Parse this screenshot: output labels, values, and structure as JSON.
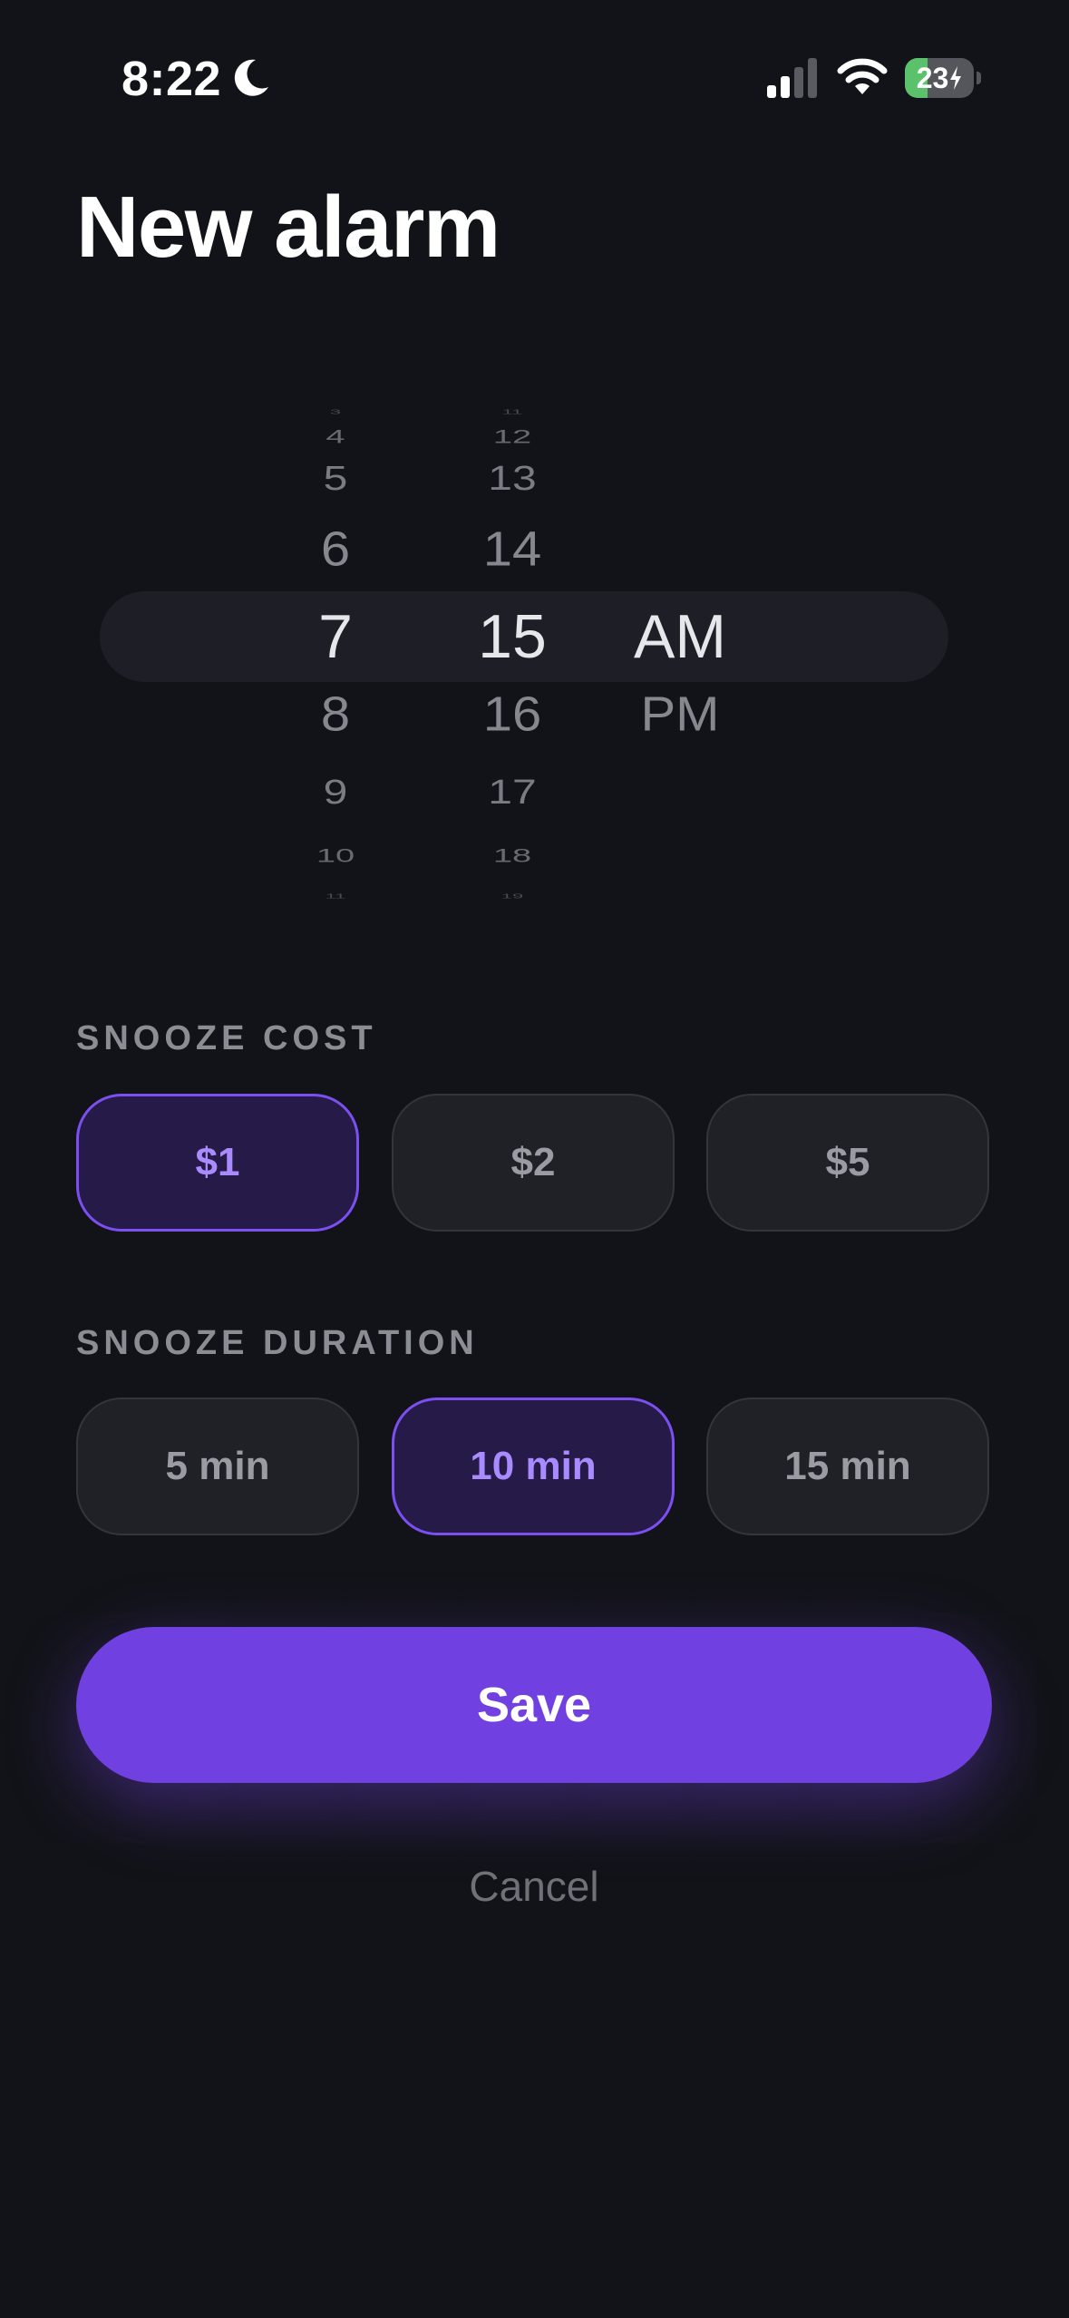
{
  "status_bar": {
    "time": "8:22",
    "battery_level": "23",
    "battery_fraction": 0.23,
    "icons": [
      "moon-icon",
      "signal-icon",
      "wifi-icon",
      "battery-icon",
      "bolt-icon"
    ]
  },
  "page_title": "New alarm",
  "picker": {
    "hours": [
      "3",
      "4",
      "5",
      "6",
      "7",
      "8",
      "9",
      "10",
      "11"
    ],
    "minutes": [
      "11",
      "12",
      "13",
      "14",
      "15",
      "16",
      "17",
      "18",
      "19"
    ],
    "periods": [
      "AM",
      "PM"
    ],
    "selected_hour": "7",
    "selected_minute": "15",
    "selected_period": "AM"
  },
  "snooze_cost": {
    "label": "SNOOZE COST",
    "options": [
      "$1",
      "$2",
      "$5"
    ],
    "selected": "$1"
  },
  "snooze_duration": {
    "label": "SNOOZE DURATION",
    "options": [
      "5 min",
      "10 min",
      "15 min"
    ],
    "selected": "10 min"
  },
  "actions": {
    "save_label": "Save",
    "cancel_label": "Cancel"
  },
  "colors": {
    "background": "#121318",
    "accent": "#7140e0",
    "accent_text": "#a98aff",
    "battery_green": "#5bc16a"
  }
}
